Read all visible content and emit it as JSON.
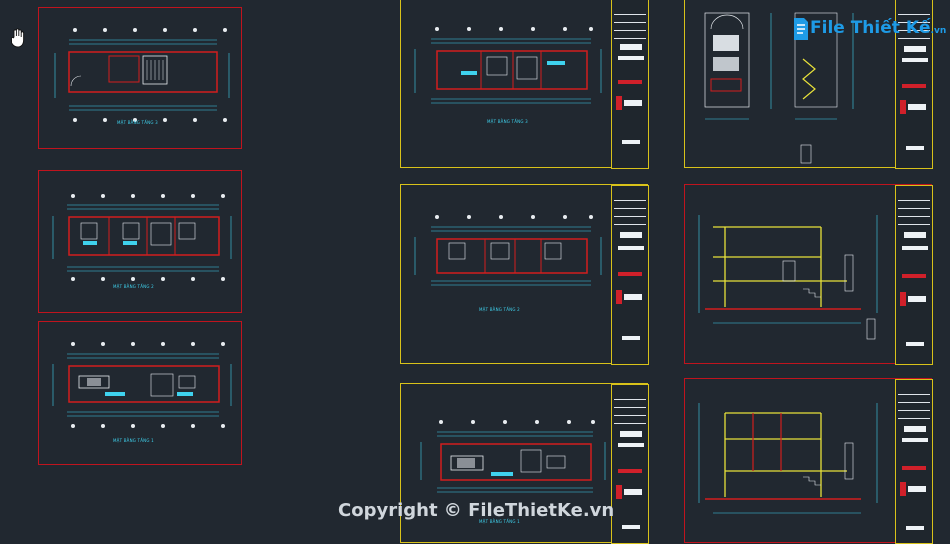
{
  "viewport": {
    "background": "#212830"
  },
  "watermark": {
    "text": "Copyright © FileThietKe.vn"
  },
  "logo": {
    "brand": "File Thiết Kế",
    "suffix": ".vn"
  },
  "cursor": {
    "icon": "hand-pan-icon"
  },
  "colors": {
    "sheet_border_red": "#c0141e",
    "sheet_border_yellow": "#d8c21a",
    "wall_red": "#d21e1e",
    "dimension_cyan": "#3fd2ee",
    "annotation_white": "#e8ecf0",
    "section_yellow": "#e8e23a"
  },
  "sheets": [
    {
      "id": "left-1",
      "caption": "MẶT BẰNG TẦNG 3",
      "border": "red"
    },
    {
      "id": "left-2",
      "caption": "MẶT BẰNG TẦNG 2",
      "border": "red"
    },
    {
      "id": "left-3",
      "caption": "MẶT BẰNG TẦNG 1",
      "border": "red"
    },
    {
      "id": "mid-1",
      "caption": "MẶT BẰNG TẦNG 3",
      "border": "yellow"
    },
    {
      "id": "mid-2",
      "caption": "MẶT BẰNG TẦNG 2",
      "border": "yellow"
    },
    {
      "id": "mid-3",
      "caption": "MẶT BẰNG TẦNG 1",
      "border": "yellow"
    },
    {
      "id": "right-1",
      "caption": "",
      "border": "yellow"
    },
    {
      "id": "right-2",
      "caption": "",
      "border": "yellow"
    },
    {
      "id": "right-3",
      "caption": "",
      "border": "yellow"
    }
  ]
}
